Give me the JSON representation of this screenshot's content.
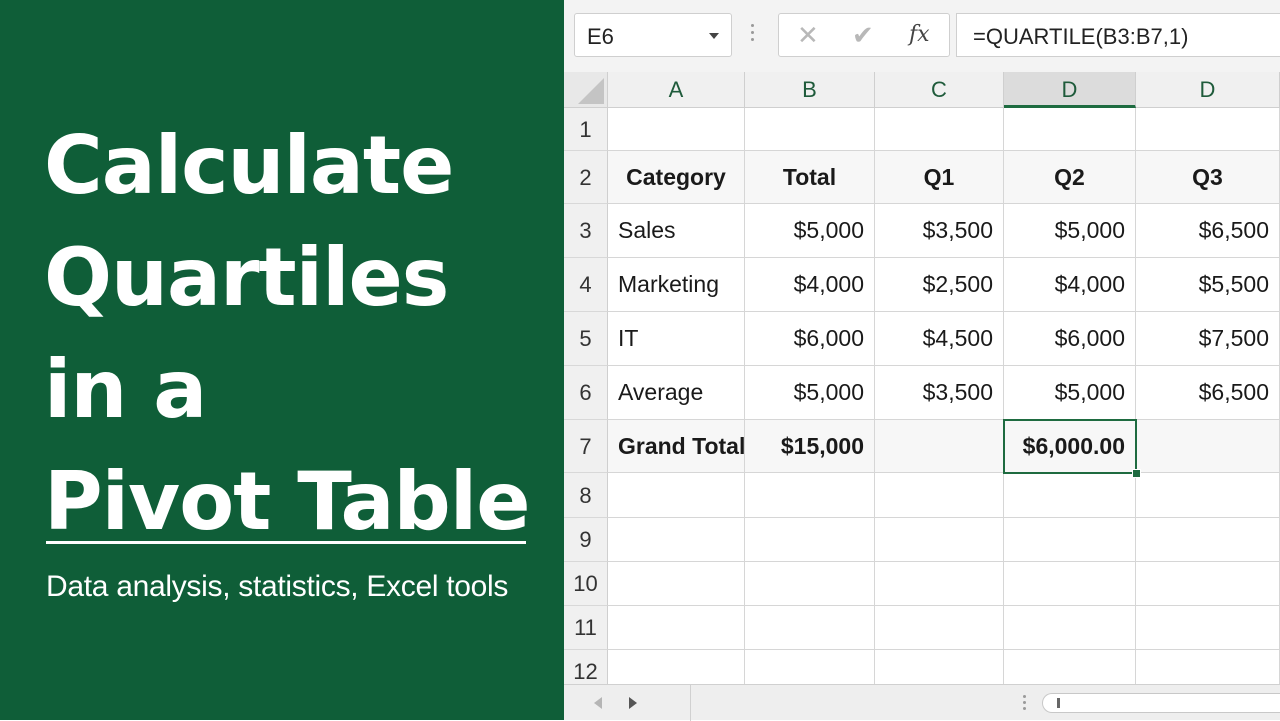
{
  "promo": {
    "title_lines": [
      "Calculate",
      "Quartiles",
      "in a",
      "Pivot Table"
    ],
    "subtitle": "Data analysis, statistics, Excel tools",
    "background": "#0f5e38"
  },
  "formula_bar": {
    "name_box": "E6",
    "cancel_icon": "close-icon",
    "enter_icon": "check-icon",
    "fx_label": "fx",
    "formula": "=QUARTILE(B3:B7,1)"
  },
  "grid": {
    "columns": [
      "A",
      "B",
      "C",
      "D",
      "D"
    ],
    "selected_column_index": 3,
    "rows": [
      "1",
      "2",
      "3",
      "4",
      "5",
      "6",
      "7",
      "8",
      "9",
      "10",
      "11",
      "12"
    ],
    "header_row": [
      "Category",
      "Total",
      "Q1",
      "Q2",
      "Q3"
    ],
    "data_rows": [
      [
        "Sales",
        "$5,000",
        "$3,500",
        "$5,000",
        "$6,500"
      ],
      [
        "Marketing",
        "$4,000",
        "$2,500",
        "$4,000",
        "$5,500"
      ],
      [
        "IT",
        "$6,000",
        "$4,500",
        "$6,000",
        "$7,500"
      ],
      [
        "Average",
        "$5,000",
        "$3,500",
        "$5,000",
        "$6,500"
      ]
    ],
    "total_row": [
      "Grand Total",
      "$15,000",
      "",
      "$6,000.00",
      ""
    ],
    "accent": "#1e6b40"
  }
}
